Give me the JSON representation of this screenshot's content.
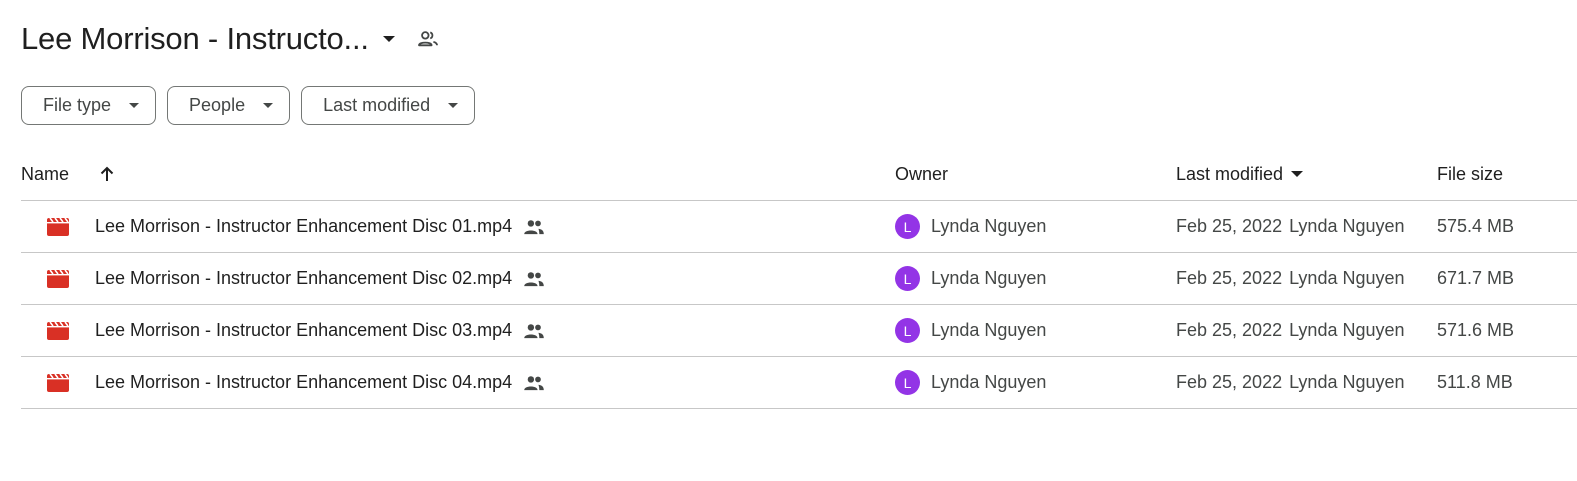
{
  "folder": {
    "title": "Lee Morrison - Instructo...",
    "caret_icon": "arrow-drop-down-icon",
    "shared_icon": "people-icon"
  },
  "filters": [
    {
      "label": "File type"
    },
    {
      "label": "People"
    },
    {
      "label": "Last modified"
    }
  ],
  "table": {
    "headers": {
      "name": "Name",
      "owner": "Owner",
      "last_modified": "Last modified",
      "file_size": "File size"
    },
    "rows": [
      {
        "name": "Lee Morrison - Instructor Enhancement Disc 01.mp4",
        "owner_initial": "L",
        "owner": "Lynda Nguyen",
        "modified_date": "Feb 25, 2022",
        "modified_by": "Lynda Nguyen",
        "size": "575.4 MB"
      },
      {
        "name": "Lee Morrison - Instructor Enhancement Disc 02.mp4",
        "owner_initial": "L",
        "owner": "Lynda Nguyen",
        "modified_date": "Feb 25, 2022",
        "modified_by": "Lynda Nguyen",
        "size": "671.7 MB"
      },
      {
        "name": "Lee Morrison - Instructor Enhancement Disc 03.mp4",
        "owner_initial": "L",
        "owner": "Lynda Nguyen",
        "modified_date": "Feb 25, 2022",
        "modified_by": "Lynda Nguyen",
        "size": "571.6 MB"
      },
      {
        "name": "Lee Morrison - Instructor Enhancement Disc 04.mp4",
        "owner_initial": "L",
        "owner": "Lynda Nguyen",
        "modified_date": "Feb 25, 2022",
        "modified_by": "Lynda Nguyen",
        "size": "511.8 MB"
      }
    ]
  },
  "colors": {
    "video_icon": "#d93025",
    "avatar": "#9334e6",
    "divider": "#c7c7c7"
  }
}
